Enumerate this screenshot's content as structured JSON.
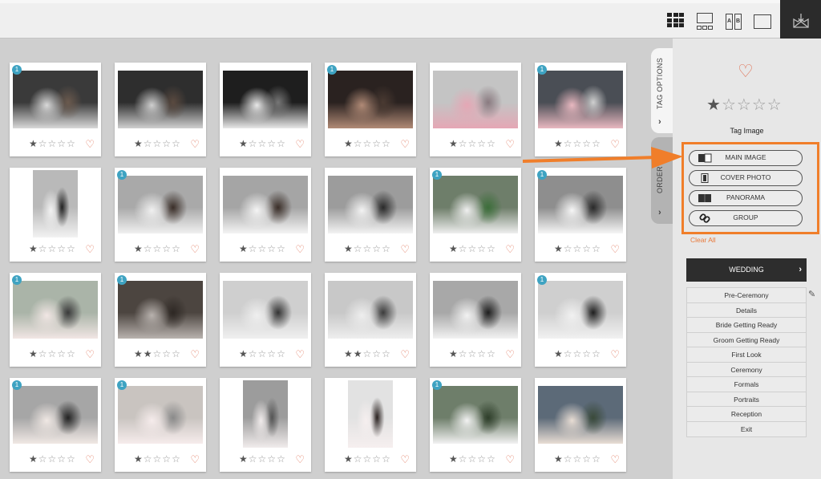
{
  "toolbar": {
    "views": [
      {
        "name": "grid-view",
        "icon": "grid-icon",
        "active": true
      },
      {
        "name": "filmstrip-view",
        "icon": "filmstrip-icon"
      },
      {
        "name": "compare-view",
        "icon": "compare-ab-icon",
        "a": "A",
        "b": "B"
      },
      {
        "name": "single-view",
        "icon": "single-image-icon"
      }
    ],
    "brand_icon": "logo-icon"
  },
  "colors": {
    "accent": "#f07e2a",
    "heart": "#e0765b",
    "badge": "#3ea3c2",
    "dark": "#2d2d2d"
  },
  "photos": [
    {
      "badge": "1",
      "rating": 1,
      "orientation": "landscape",
      "tone": [
        "#3a3a3a",
        "#d8d8d8",
        "#6b5a4e"
      ]
    },
    {
      "badge": "",
      "rating": 1,
      "orientation": "landscape",
      "tone": [
        "#2e2e2e",
        "#cfcfcf",
        "#5a4a40"
      ]
    },
    {
      "badge": "",
      "rating": 1,
      "orientation": "landscape",
      "tone": [
        "#1e1e1e",
        "#e8e8e8",
        "#777777"
      ]
    },
    {
      "badge": "1",
      "rating": 1,
      "orientation": "landscape",
      "tone": [
        "#2a2220",
        "#b08a76",
        "#4a3a32"
      ]
    },
    {
      "badge": "",
      "rating": 1,
      "orientation": "landscape",
      "tone": [
        "#c4c4c4",
        "#e5a7b5",
        "#8a7a80"
      ]
    },
    {
      "badge": "1",
      "rating": 1,
      "orientation": "landscape",
      "tone": [
        "#4a4e55",
        "#e8b8c0",
        "#d0d0d0"
      ]
    },
    {
      "badge": "",
      "rating": 1,
      "orientation": "portrait",
      "tone": [
        "#b9b9b9",
        "#f2f2f2",
        "#222222"
      ]
    },
    {
      "badge": "1",
      "rating": 1,
      "orientation": "landscape",
      "tone": [
        "#a9a9a9",
        "#f0f0f0",
        "#3a2e28"
      ]
    },
    {
      "badge": "",
      "rating": 1,
      "orientation": "landscape",
      "tone": [
        "#a5a5a5",
        "#f4f4f4",
        "#3a2e28"
      ]
    },
    {
      "badge": "",
      "rating": 1,
      "orientation": "landscape",
      "tone": [
        "#9c9c9c",
        "#f3f3f3",
        "#2a2a2a"
      ]
    },
    {
      "badge": "1",
      "rating": 1,
      "orientation": "landscape",
      "tone": [
        "#6e7e6a",
        "#efefef",
        "#3c6e3a"
      ]
    },
    {
      "badge": "1",
      "rating": 1,
      "orientation": "landscape",
      "tone": [
        "#8e8e8e",
        "#f6f6f6",
        "#2a2a2a"
      ]
    },
    {
      "badge": "1",
      "rating": 1,
      "orientation": "landscape",
      "tone": [
        "#aab4a8",
        "#f1e6e4",
        "#3a3a3a"
      ]
    },
    {
      "badge": "1",
      "rating": 2,
      "orientation": "landscape",
      "tone": [
        "#4c4540",
        "#b8b2ae",
        "#2e2824"
      ]
    },
    {
      "badge": "",
      "rating": 1,
      "orientation": "landscape",
      "tone": [
        "#cfcfcf",
        "#efefef",
        "#333333"
      ]
    },
    {
      "badge": "",
      "rating": 2,
      "orientation": "landscape",
      "tone": [
        "#c8c8c8",
        "#eeeeee",
        "#3c3c3c"
      ]
    },
    {
      "badge": "",
      "rating": 1,
      "orientation": "landscape",
      "tone": [
        "#a8a8a8",
        "#f2f2f2",
        "#1e1e1e"
      ]
    },
    {
      "badge": "1",
      "rating": 1,
      "orientation": "landscape",
      "tone": [
        "#cfcfcf",
        "#f1f1f1",
        "#1e1e1e"
      ]
    },
    {
      "badge": "1",
      "rating": 1,
      "orientation": "landscape",
      "tone": [
        "#a6a6a6",
        "#f0e8e4",
        "#222222"
      ]
    },
    {
      "badge": "1",
      "rating": 1,
      "orientation": "landscape",
      "tone": [
        "#c9c4c0",
        "#f6ecec",
        "#8a8a8a"
      ]
    },
    {
      "badge": "",
      "rating": 1,
      "orientation": "portrait",
      "tone": [
        "#9c9c9c",
        "#f1ecec",
        "#555555"
      ]
    },
    {
      "badge": "",
      "rating": 1,
      "orientation": "portrait",
      "tone": [
        "#e2e2e2",
        "#f6efef",
        "#2a2220"
      ]
    },
    {
      "badge": "1",
      "rating": 1,
      "orientation": "landscape",
      "tone": [
        "#6e7e6a",
        "#f2f2f2",
        "#2e3e2a"
      ]
    },
    {
      "badge": "",
      "rating": 1,
      "orientation": "landscape",
      "tone": [
        "#5c6a78",
        "#e8ddd4",
        "#3a4a3a"
      ]
    }
  ],
  "side_tabs": {
    "tag_options": {
      "label": "TAG OPTIONS",
      "chevron": "›"
    },
    "order": {
      "label": "ORDER",
      "chevron": "›"
    }
  },
  "panel": {
    "favorite_icon": "heart-icon",
    "rating": 1,
    "rating_max": 5,
    "tag_label": "Tag Image",
    "tag_buttons": [
      {
        "label": "MAIN IMAGE",
        "icon": "open-book-icon"
      },
      {
        "label": "COVER PHOTO",
        "icon": "cover-photo-icon"
      },
      {
        "label": "PANORAMA",
        "icon": "panorama-book-icon"
      },
      {
        "label": "GROUP",
        "icon": "link-chain-icon"
      }
    ],
    "clear_all": "Clear All",
    "album": {
      "label": "WEDDING",
      "chevron": "›"
    },
    "categories": [
      "Pre-Ceremony",
      "Details",
      "Bride Getting Ready",
      "Groom Getting Ready",
      "First Look",
      "Ceremony",
      "Formals",
      "Portraits",
      "Reception",
      "Exit"
    ]
  }
}
